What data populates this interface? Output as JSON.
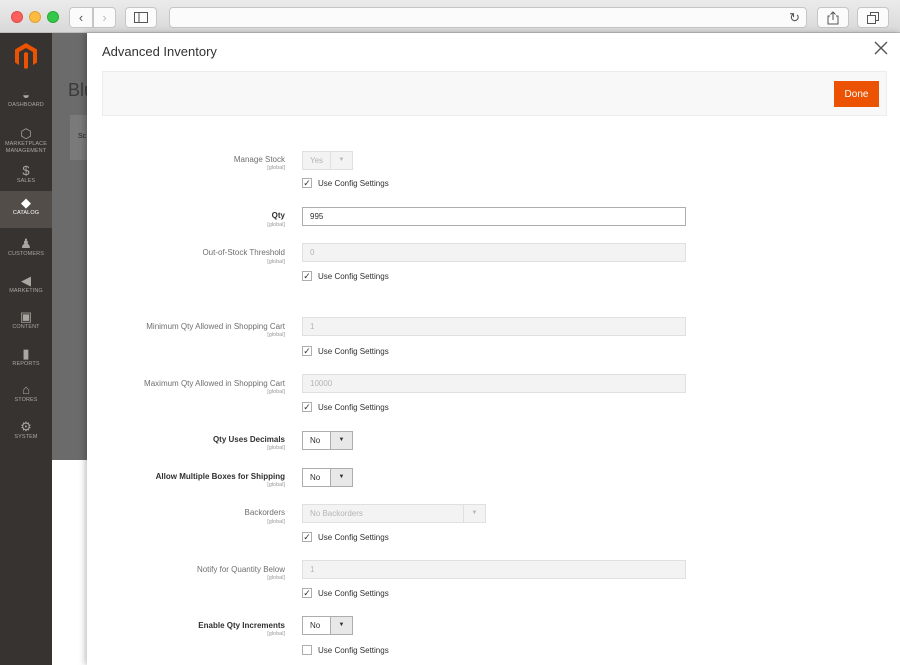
{
  "browser": {
    "back_icon": "‹",
    "forward_icon": "›",
    "sidebar_icon": "sidebar-icon",
    "reload_icon": "↻",
    "share_icon": "share-icon",
    "tabs_icon": "tabs-icon"
  },
  "menu": {
    "items": [
      {
        "label": "DASHBOARD",
        "icon": "dashboard-icon",
        "glyph": "◒"
      },
      {
        "label": "MARKETPLACE MANAGEMENT",
        "icon": "hexagon-icon",
        "glyph": "⬡"
      },
      {
        "label": "SALES",
        "icon": "dollar-icon",
        "glyph": "$"
      },
      {
        "label": "CATALOG",
        "icon": "cube-icon",
        "glyph": "◆",
        "active": true
      },
      {
        "label": "CUSTOMERS",
        "icon": "person-icon",
        "glyph": "♟"
      },
      {
        "label": "MARKETING",
        "icon": "megaphone-icon",
        "glyph": "◀"
      },
      {
        "label": "CONTENT",
        "icon": "content-icon",
        "glyph": "▣"
      },
      {
        "label": "REPORTS",
        "icon": "bar-chart-icon",
        "glyph": "▮"
      },
      {
        "label": "STORES",
        "icon": "store-icon",
        "glyph": "⌂"
      },
      {
        "label": "SYSTEM",
        "icon": "gear-icon",
        "glyph": "⚙"
      }
    ]
  },
  "background_page": {
    "title": "Blu",
    "card_text": "Sc"
  },
  "modal": {
    "title": "Advanced Inventory",
    "done_label": "Done",
    "accent_color": "#eb5202",
    "use_config_label": "Use Config Settings",
    "scope_label": "[global]",
    "fields": {
      "manage_stock": {
        "label": "Manage Stock",
        "value": "Yes",
        "use_config": true
      },
      "qty": {
        "label": "Qty",
        "value": "995"
      },
      "out_of_stock_threshold": {
        "label": "Out-of-Stock Threshold",
        "value": "0",
        "use_config": true
      },
      "min_qty_cart": {
        "label": "Minimum Qty Allowed in Shopping Cart",
        "value": "1",
        "use_config": true
      },
      "max_qty_cart": {
        "label": "Maximum Qty Allowed in Shopping Cart",
        "value": "10000",
        "use_config": true
      },
      "qty_uses_decimals": {
        "label": "Qty Uses Decimals",
        "value": "No"
      },
      "multiple_boxes": {
        "label": "Allow Multiple Boxes for Shipping",
        "value": "No"
      },
      "backorders": {
        "label": "Backorders",
        "value": "No Backorders",
        "use_config": true
      },
      "notify_qty_below": {
        "label": "Notify for Quantity Below",
        "value": "1",
        "use_config": true
      },
      "enable_qty_increments": {
        "label": "Enable Qty Increments",
        "value": "No",
        "use_config": false
      }
    }
  }
}
